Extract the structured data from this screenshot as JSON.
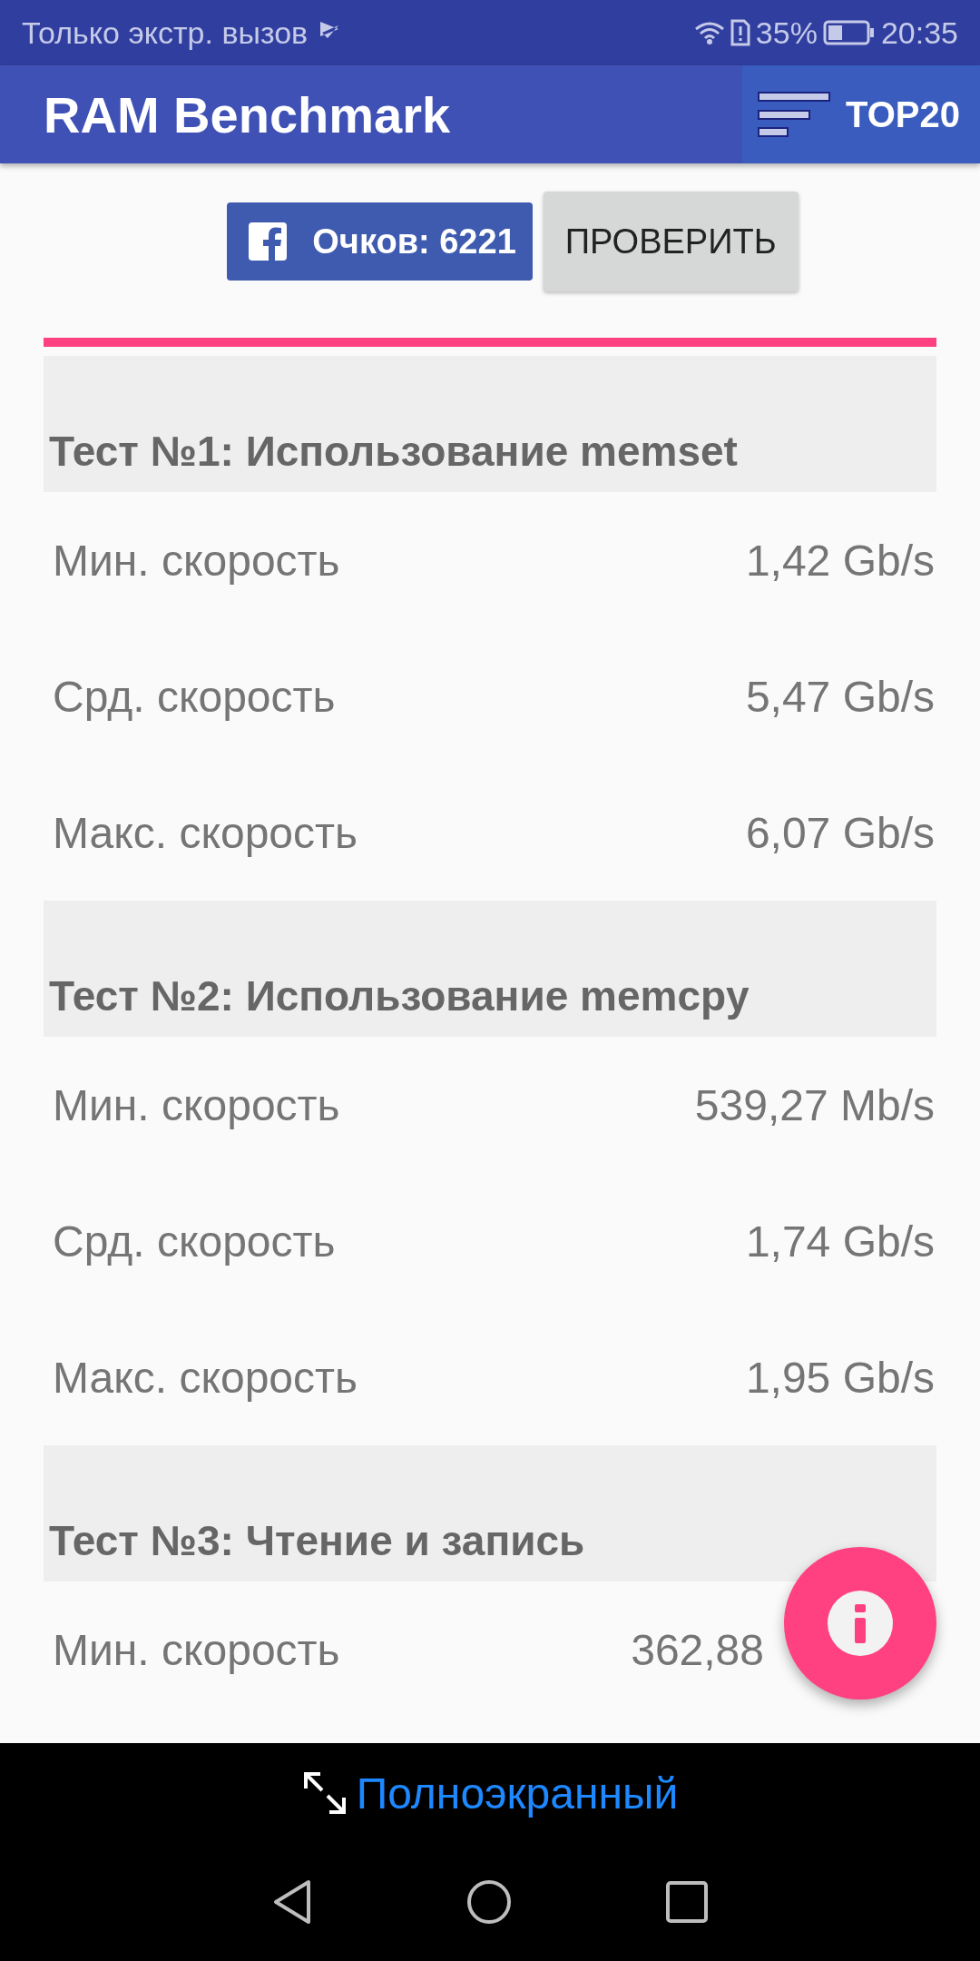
{
  "status_bar": {
    "carrier": "Только экстр. вызов",
    "battery_percent": "35%",
    "time": "20:35"
  },
  "app_bar": {
    "title": "RAM Benchmark",
    "top_button": "TOP20"
  },
  "score_button": "Очков: 6221",
  "check_button": "ПРОВЕРИТЬ",
  "sections": [
    {
      "title": "Тест №1: Использование memset",
      "rows": [
        {
          "label": "Мин. скорость",
          "value": "1,42 Gb/s"
        },
        {
          "label": "Срд. скорость",
          "value": "5,47 Gb/s"
        },
        {
          "label": "Макс. скорость",
          "value": "6,07 Gb/s"
        }
      ]
    },
    {
      "title": "Тест №2: Использование memcpy",
      "rows": [
        {
          "label": "Мин. скорость",
          "value": "539,27 Mb/s"
        },
        {
          "label": "Срд. скорость",
          "value": "1,74 Gb/s"
        },
        {
          "label": "Макс. скорость",
          "value": "1,95 Gb/s"
        }
      ]
    },
    {
      "title": "Тест №3: Чтение и запись",
      "rows": [
        {
          "label": "Мин. скорость",
          "value": "362,88"
        }
      ]
    }
  ],
  "fullscreen_link": "Полноэкранный"
}
